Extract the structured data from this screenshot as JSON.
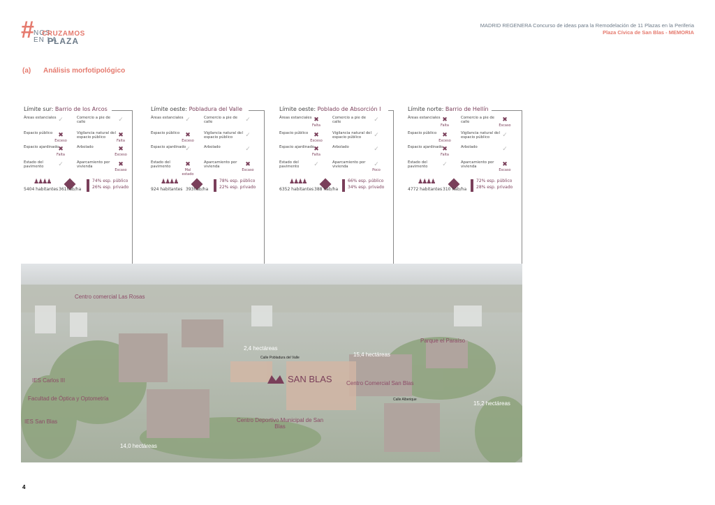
{
  "logo": {
    "hash": "#",
    "line1": "NOS",
    "line2": "CRUZAMOS",
    "line3": "EN LA",
    "line4": "PLAZA"
  },
  "header": {
    "line1": "MADRID REGENERA Concurso de ideas para la Remodelación de 11 Plazas en la Periferia",
    "line2": "Plaza Cívica de San Blas - MEMORIA"
  },
  "section": {
    "num": "(a)",
    "title": "Análisis morfotipológico"
  },
  "panels": [
    {
      "prefix": "Límite sur: ",
      "name": "Barrio de los Arcos",
      "rows": [
        "Áreas estanciales",
        "Espacio público",
        "Espacio ajardinado",
        "Estado del pavimento"
      ],
      "rows2": [
        "Comercio a pie de calle",
        "Vigilancia natural del espacio público",
        "Arbolado",
        "Aparcamiento por vivienda"
      ],
      "marks1": [
        {
          "t": "✓",
          "cap": ""
        },
        {
          "t": "✖",
          "cap": "Exceso"
        },
        {
          "t": "✖",
          "cap": "Falta"
        },
        {
          "t": "✓",
          "cap": ""
        }
      ],
      "marks2": [
        {
          "t": "✓",
          "cap": ""
        },
        {
          "t": "✖",
          "cap": "Falta"
        },
        {
          "t": "✖",
          "cap": "Exceso"
        },
        {
          "t": "✖",
          "cap": "Escaso"
        }
      ],
      "habitantes": "5404 habitantes",
      "densidad": "361hab/ha",
      "publico": "74% esp. público",
      "privado": "26% esp. privado"
    },
    {
      "prefix": "Límite oeste: ",
      "name": "Pobladura del Valle",
      "rows": [
        "Áreas estanciales",
        "Espacio público",
        "Espacio ajardinado",
        "Estado del pavimento"
      ],
      "rows2": [
        "Comercio a pie de calle",
        "Vigilancia natural del espacio público",
        "Arbolado",
        "Aparcamiento por vivienda"
      ],
      "marks1": [
        {
          "t": "✓",
          "cap": ""
        },
        {
          "t": "✖",
          "cap": "Exceso"
        },
        {
          "t": "✓",
          "cap": ""
        },
        {
          "t": "✖",
          "cap": "Mal estado"
        }
      ],
      "marks2": [
        {
          "t": "✓",
          "cap": ""
        },
        {
          "t": "✓",
          "cap": ""
        },
        {
          "t": "✓",
          "cap": ""
        },
        {
          "t": "✖",
          "cap": "Escaso"
        }
      ],
      "habitantes": "924 habitantes",
      "densidad": "393hab/ha",
      "publico": "78% esp. público",
      "privado": "22% esp. privado"
    },
    {
      "prefix": "Límite oeste: ",
      "name": "Poblado de Absorción I",
      "rows": [
        "Áreas estanciales",
        "Espacio público",
        "Espacio ajardinado",
        "Estado del pavimento"
      ],
      "rows2": [
        "Comercio a pie de calle",
        "Vigilancia natural del espacio público",
        "Arbolado",
        "Aparcamiento por vivienda"
      ],
      "marks1": [
        {
          "t": "✖",
          "cap": "Falta"
        },
        {
          "t": "✖",
          "cap": "Exceso"
        },
        {
          "t": "✖",
          "cap": "Falta"
        },
        {
          "t": "✓",
          "cap": ""
        }
      ],
      "marks2": [
        {
          "t": "✓",
          "cap": ""
        },
        {
          "t": "✓",
          "cap": ""
        },
        {
          "t": "✓",
          "cap": ""
        },
        {
          "t": "✓",
          "cap": "Poco"
        }
      ],
      "habitantes": "6352 habitantes",
      "densidad": "388 hab/ha",
      "publico": "66% esp. público",
      "privado": "34% esp. privado"
    },
    {
      "prefix": "Límite norte: ",
      "name": "Barrio de Hellín",
      "rows": [
        "Áreas estanciales",
        "Espacio público",
        "Espacio ajardinado",
        "Estado del pavimento"
      ],
      "rows2": [
        "Comercio a pie de calle",
        "Vigilancia natural del espacio público",
        "Arbolado",
        "Aparcamiento por vivienda"
      ],
      "marks1": [
        {
          "t": "✖",
          "cap": "Falta"
        },
        {
          "t": "✖",
          "cap": "Exceso"
        },
        {
          "t": "✖",
          "cap": "Falta"
        },
        {
          "t": "✓",
          "cap": ""
        }
      ],
      "marks2": [
        {
          "t": "✖",
          "cap": "Escaso"
        },
        {
          "t": "✓",
          "cap": ""
        },
        {
          "t": "✓",
          "cap": ""
        },
        {
          "t": "✖",
          "cap": "Escaso"
        }
      ],
      "habitantes": "4772 habitantes",
      "densidad": "310 hab/ha",
      "publico": "72% esp. público",
      "privado": "28% esp. privado"
    }
  ],
  "map_labels": {
    "centro_las_rosas": "Centro comercial Las Rosas",
    "ies_carlos": "IES Carlos III",
    "facultad": "Facultad de Óptica y Optometría",
    "ies_san_blas": "IES San Blas",
    "ha_14": "14,0 hectáreas",
    "ha_2": "2,4 hectáreas",
    "calle_pobladura": "Calle Pobladura del Valle",
    "ha_15_4": "15,4 hectáreas",
    "parque": "Parque el Paraíso",
    "san_blas": "SAN BLAS",
    "centro_san_blas": "Centro Comercial San Blas",
    "calle_alberique": "Calle Alberique",
    "ha_15_2": "15,2 hectáreas",
    "centro_deportivo": "Centro Deportivo Municipal de San Blas"
  },
  "page_number": "4"
}
